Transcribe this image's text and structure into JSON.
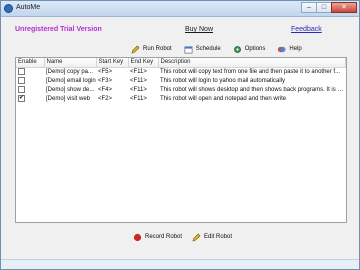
{
  "window": {
    "title": "AutoMe",
    "icon": "app-icon",
    "controls": [
      "minimize",
      "maximize",
      "close"
    ]
  },
  "header": {
    "unregistered": "Unregistered Trial Version",
    "buy_now": "Buy Now",
    "feedback": "Feedback"
  },
  "toolbar": {
    "run_robot": "Run Robot",
    "schedule": "Schedule",
    "options": "Options",
    "help": "Help"
  },
  "table": {
    "columns": [
      "Enable",
      "Name",
      "Start Key",
      "End Key",
      "Description"
    ],
    "rows": [
      {
        "enabled": false,
        "name": "[Demo] copy pa...",
        "start": "<F5>",
        "end": "<F11>",
        "description": "This robot will copy text from one file and then paste it to another f..."
      },
      {
        "enabled": false,
        "name": "[Demo] email login",
        "start": "<F3>",
        "end": "<F11>",
        "description": "This robot will login to yahoo mail automatically"
      },
      {
        "enabled": false,
        "name": "[Demo] show de...",
        "start": "<F4>",
        "end": "<F11>",
        "description": "This robot will shows desktop and then shows back programs. It is cr..."
      },
      {
        "enabled": true,
        "name": "[Demo] visit web",
        "start": "<F2>",
        "end": "<F11>",
        "description": "This robot will open and notepad and then write"
      }
    ]
  },
  "bottom": {
    "record_robot": "Record Robot",
    "edit_robot": "Edit Robot"
  },
  "colors": {
    "trial": "#b52fd1",
    "feedback_link": "#2a2ab8",
    "record": "#c62828"
  }
}
